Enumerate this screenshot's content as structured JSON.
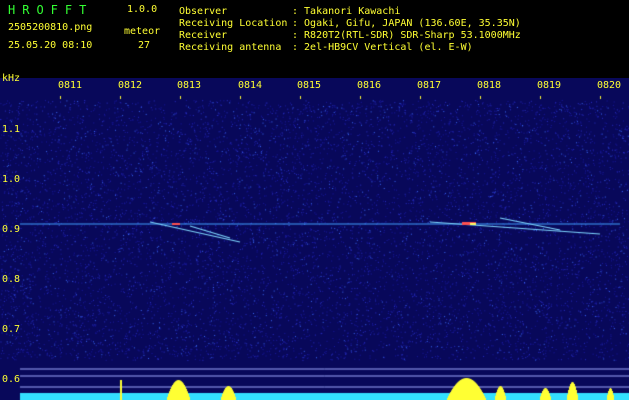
{
  "header": {
    "app_name": "HROFFT",
    "version": "1.0.0",
    "filename": "2505200810.png",
    "datetime": "25.05.20 08:10",
    "meteor_label": "meteor",
    "meteor_count": "27",
    "fields": [
      {
        "label": "Observer",
        "value": ": Takanori Kawachi"
      },
      {
        "label": "Receiving Location",
        "value": ": Ogaki, Gifu, JAPAN (136.60E, 35.35N)"
      },
      {
        "label": "Receiver",
        "value": ": R820T2(RTL-SDR) SDR-Sharp 53.1000MHz"
      },
      {
        "label": "Receiving antenna",
        "value": ": 2el-HB9CV Vertical (el. E-W)"
      }
    ]
  },
  "spectrogram": {
    "unit_label": "kHz",
    "time_labels": [
      "0811",
      "0812",
      "0813",
      "0814",
      "0815",
      "0816",
      "0817",
      "0818",
      "0819",
      "0820"
    ],
    "freq_labels": [
      "1.1",
      "1.0",
      "0.9",
      "0.8",
      "0.7",
      "0.6"
    ],
    "colors": {
      "background": "#08085a",
      "signal": "#40a0ff",
      "level_fill": "#33e0ff",
      "spike": "#ffff33"
    }
  }
}
